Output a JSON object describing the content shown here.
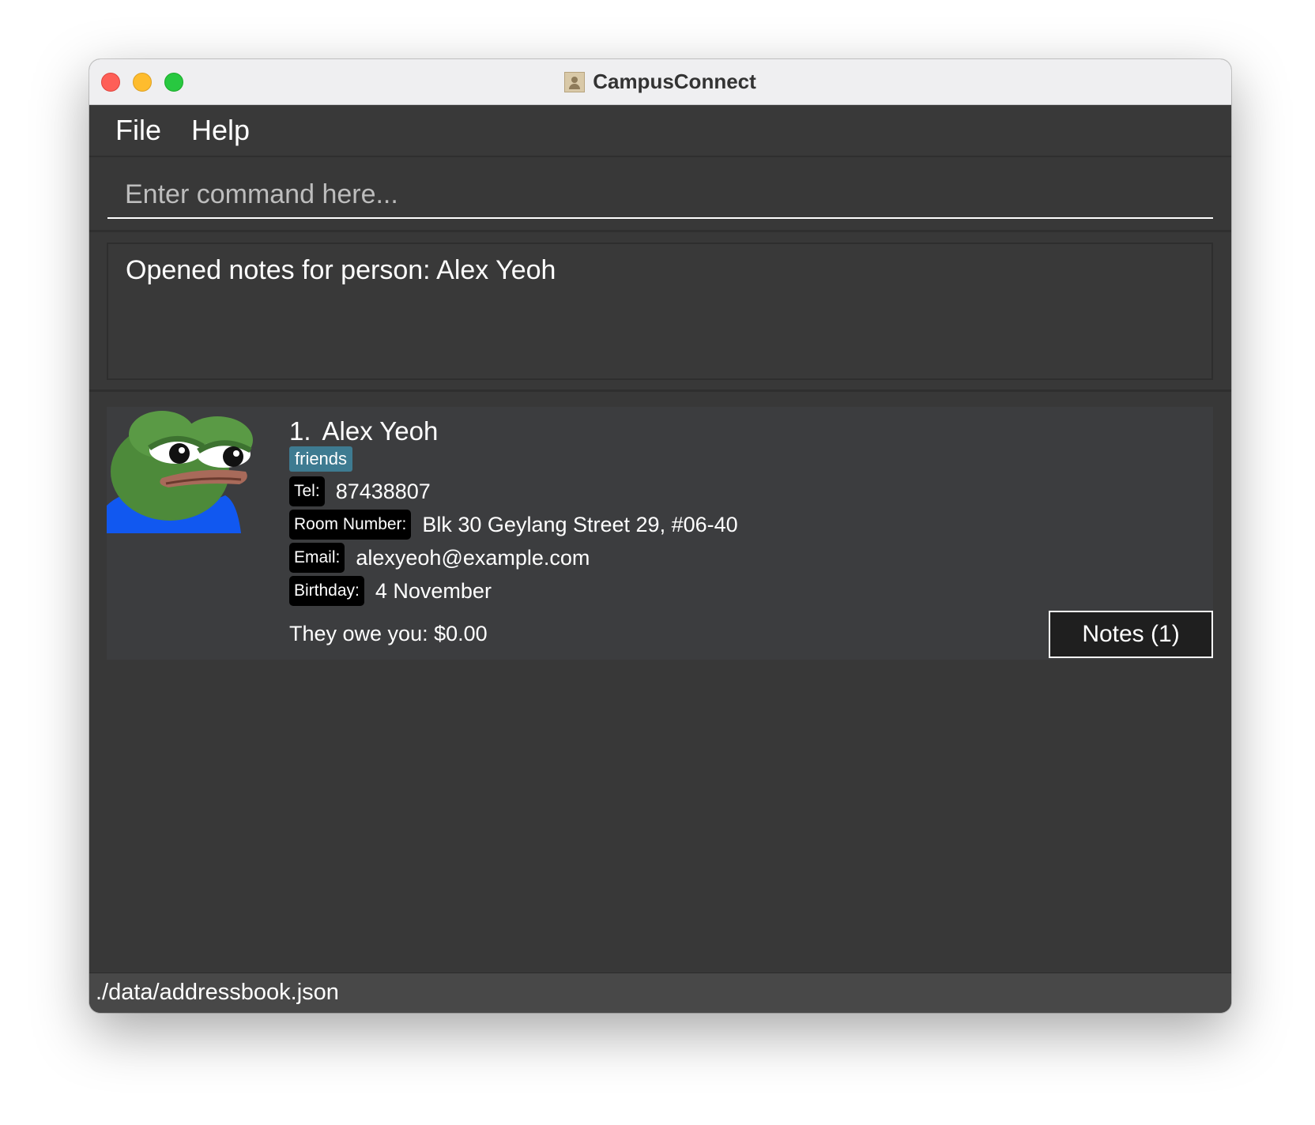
{
  "window": {
    "title": "CampusConnect"
  },
  "menu": {
    "items": [
      "File",
      "Help"
    ]
  },
  "command": {
    "placeholder": "Enter command here..."
  },
  "result": {
    "message": "Opened notes for person: Alex Yeoh"
  },
  "person": {
    "index": "1.",
    "name": "Alex Yeoh",
    "tag": "friends",
    "fields": [
      {
        "label": "Tel:",
        "value": "87438807"
      },
      {
        "label": "Room Number:",
        "value": "Blk 30 Geylang Street 29, #06-40"
      },
      {
        "label": "Email:",
        "value": "alexyeoh@example.com"
      },
      {
        "label": "Birthday:",
        "value": "4 November"
      }
    ],
    "owe": "They owe you: $0.00",
    "notes_button": "Notes (1)",
    "avatar_icon": "frog-avatar-icon"
  },
  "status": {
    "path": "./data/addressbook.json"
  },
  "colors": {
    "tag_bg": "#3e7b91",
    "panel_bg": "#383838",
    "card_bg": "#3c3d3f",
    "accent_blue": "#1158f0",
    "frog_green": "#4d8a3a"
  }
}
